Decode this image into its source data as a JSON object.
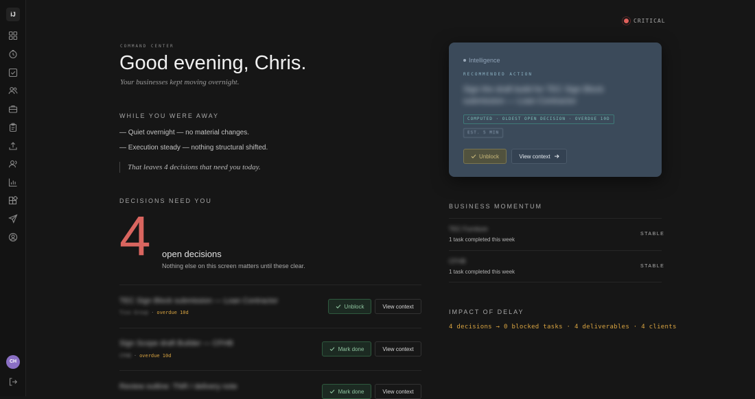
{
  "app": {
    "logo_text": "iJ"
  },
  "sidebar": {
    "icons": [
      "grid-icon",
      "clock-icon",
      "checkbox-icon",
      "people-icon",
      "briefcase-icon",
      "clipboard-icon",
      "upload-icon",
      "contacts-icon",
      "bar-chart-icon",
      "apps-icon",
      "send-icon",
      "user-circle-icon"
    ],
    "avatar_initials": "CH",
    "signout_icon": "sign-out-icon"
  },
  "status": {
    "label": "CRITICAL",
    "color": "#e0605b"
  },
  "header": {
    "eyebrow": "COMMAND CENTER",
    "greeting": "Good evening, Chris.",
    "subtitle": "Your businesses kept moving overnight."
  },
  "away": {
    "label": "WHILE YOU WERE AWAY",
    "items": [
      "— Quiet overnight — no material changes.",
      "— Execution steady — nothing structural shifted."
    ],
    "summary": "That leaves 4 decisions that need you today."
  },
  "decisions": {
    "label": "DECISIONS NEED YOU",
    "count": "4",
    "count_label": "open decisions",
    "count_sub": "Nothing else on this screen matters until these clear.",
    "rows": [
      {
        "title": "TEC Sign Block submission — Loan Contractor",
        "client": "Tixo Group",
        "overdue": "overdue 10d",
        "action": "Unblock",
        "context": "View context"
      },
      {
        "title": "Sign Scope draft Builder — CFHB",
        "client": "CFHB",
        "overdue": "overdue 10d",
        "action": "Mark done",
        "context": "View context"
      },
      {
        "title": "Review outline: TNR / delivery note",
        "client": "",
        "overdue": "",
        "action": "Mark done",
        "context": "View context"
      }
    ]
  },
  "intelligence": {
    "label": "Intelligence",
    "eyebrow": "RECOMMENDED ACTION",
    "title": "Sign the draft build for TEC Sign Block submission — Loan Contractor",
    "chip_primary": "COMPUTED · OLDEST OPEN DECISION · OVERDUE 10D",
    "chip_secondary": "EST. 5 MIN",
    "primary_button": "Unblock",
    "secondary_button": "View context"
  },
  "momentum": {
    "label": "BUSINESS MOMENTUM",
    "rows": [
      {
        "name": "TEC Furniture",
        "sub": "1 task completed this week",
        "status": "STABLE"
      },
      {
        "name": "CFHB",
        "sub": "1 task completed this week",
        "status": "STABLE"
      }
    ]
  },
  "impact": {
    "label": "IMPACT OF DELAY",
    "line": "4 decisions → 0 blocked tasks · 4 deliverables · 4 clients"
  },
  "colors": {
    "background": "#161616",
    "accent_red": "#d9655f",
    "accent_amber": "#d9a441",
    "card_blue": "#3b4a5a",
    "success_green": "#8fc49f"
  }
}
